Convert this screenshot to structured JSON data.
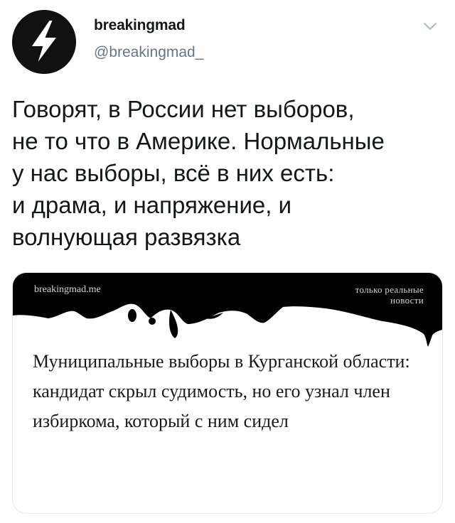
{
  "tweet": {
    "author": {
      "display_name": "breakingmad",
      "handle": "@breakingmad_",
      "avatar_icon": "lightning-bolt-icon"
    },
    "menu_icon": "chevron-down-icon",
    "text": "Говорят, в России нет выборов,\nне то что в Америке. Нормальные\nу нас выборы, всё в них есть:\nи драма, и напряжение, и\nволнующая развязка"
  },
  "card": {
    "site_name": "breakingmad.me",
    "tagline": "только реальные\nновости",
    "headline": "Муниципальные выборы в Курганской области: кандидат скрыл судимость, но его узнал член избиркома, который с ним сидел"
  },
  "colors": {
    "text_primary": "#14171a",
    "text_secondary": "#657786",
    "card_border": "#e1e8ed",
    "banner_black": "#000000"
  }
}
